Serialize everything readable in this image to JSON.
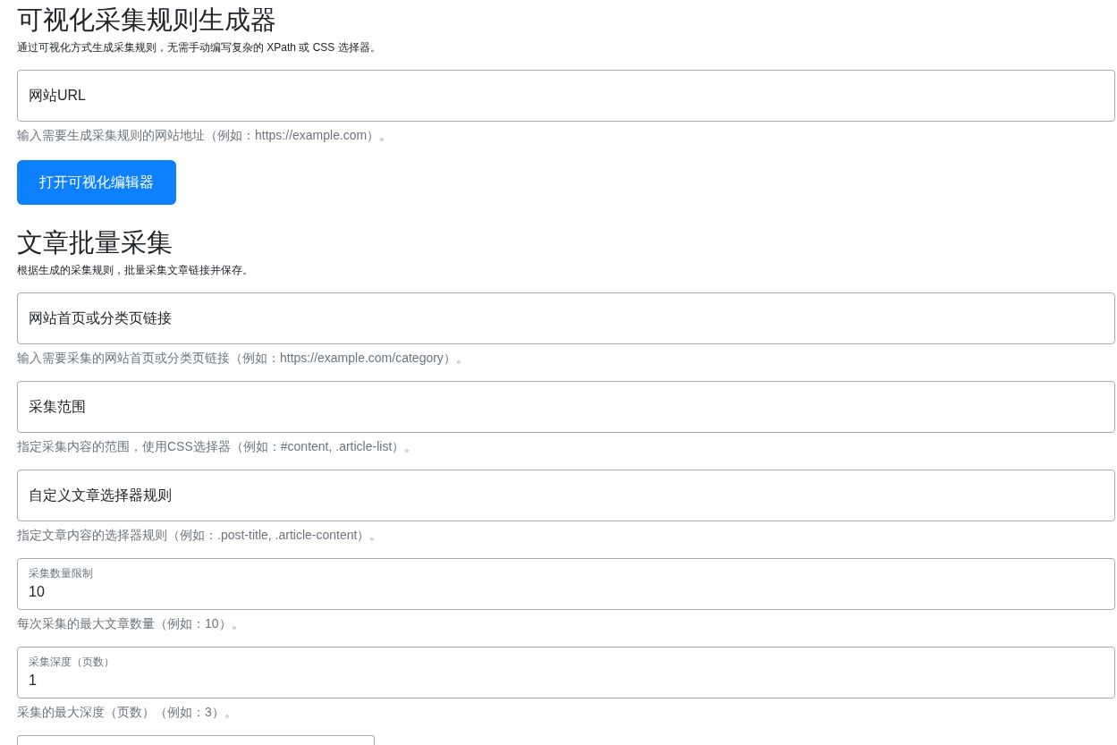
{
  "sections": [
    {
      "title": "可视化采集规则生成器",
      "description": "通过可视化方式生成采集规则，无需手动编写复杂的 XPath 或 CSS 选择器。",
      "fields": [
        {
          "placeholder": "网站URL",
          "help": "输入需要生成采集规则的网站地址（例如：https://example.com）。"
        }
      ],
      "button": "打开可视化编辑器"
    },
    {
      "title": "文章批量采集",
      "description": "根据生成的采集规则，批量采集文章链接并保存。",
      "fields": [
        {
          "placeholder": "网站首页或分类页链接",
          "help": "输入需要采集的网站首页或分类页链接（例如：https://example.com/category）。"
        },
        {
          "placeholder": "采集范围",
          "help": "指定采集内容的范围，使用CSS选择器（例如：#content, .article-list）。"
        },
        {
          "placeholder": "自定义文章选择器规则",
          "help": "指定文章内容的选择器规则（例如：.post-title, .article-content）。"
        },
        {
          "label": "采集数量限制",
          "value": "10",
          "help": "每次采集的最大文章数量（例如：10）。"
        },
        {
          "label": "采集深度（页数）",
          "value": "1",
          "help": "采集的最大深度（页数）（例如：3）。"
        }
      ]
    }
  ]
}
